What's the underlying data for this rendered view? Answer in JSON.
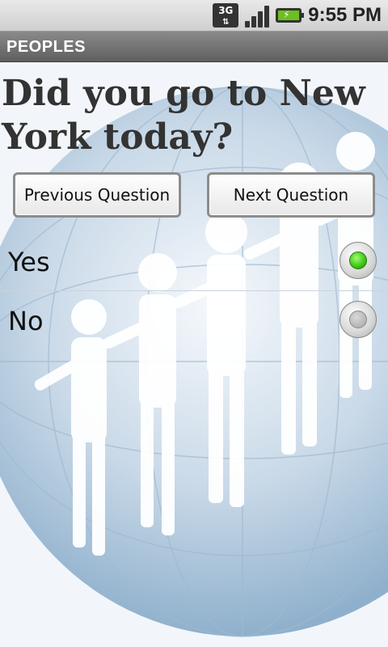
{
  "status_bar": {
    "network_label": "3G",
    "time": "9:55 PM"
  },
  "app": {
    "title": "PEOPLES"
  },
  "question": {
    "text": "Did you go to New York today?"
  },
  "buttons": {
    "previous_label": "Previous Question",
    "next_label": "Next Question"
  },
  "options": [
    {
      "label": "Yes",
      "selected": true
    },
    {
      "label": "No",
      "selected": false
    }
  ],
  "colors": {
    "selected_radio": "#2fb80a",
    "title_bar": "#6f6f6f"
  },
  "icons": {
    "network": "3g-data-icon",
    "signal": "signal-strength-icon",
    "battery": "battery-charging-icon"
  }
}
